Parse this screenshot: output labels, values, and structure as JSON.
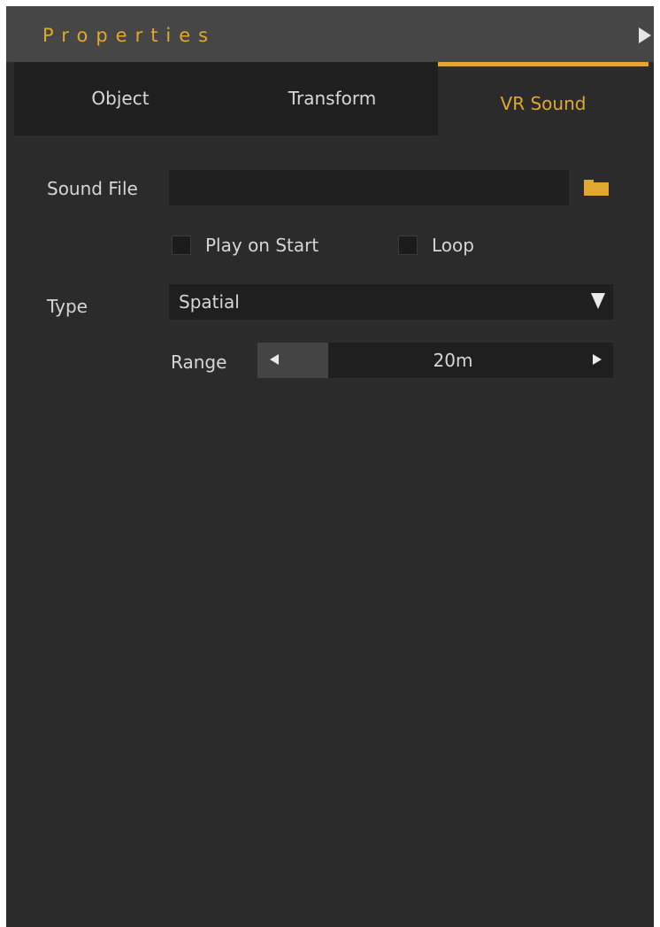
{
  "panel": {
    "title": "Properties",
    "collapse_icon": "play-triangle-right"
  },
  "tabs": [
    {
      "label": "Object",
      "active": false
    },
    {
      "label": "Transform",
      "active": false
    },
    {
      "label": "VR Sound",
      "active": true
    }
  ],
  "sound_file": {
    "label": "Sound File",
    "value": "",
    "browse_icon": "folder-icon"
  },
  "options": {
    "play_on_start": {
      "label": "Play on Start",
      "checked": false
    },
    "loop": {
      "label": "Loop",
      "checked": false
    }
  },
  "type": {
    "label": "Type",
    "selected": "Spatial"
  },
  "range": {
    "label": "Range",
    "value": "20m"
  },
  "colors": {
    "accent": "#e0a82e",
    "panel_bg": "#2b2b2b",
    "field_bg": "#1f1f1f",
    "titlebar_bg": "#464646"
  }
}
